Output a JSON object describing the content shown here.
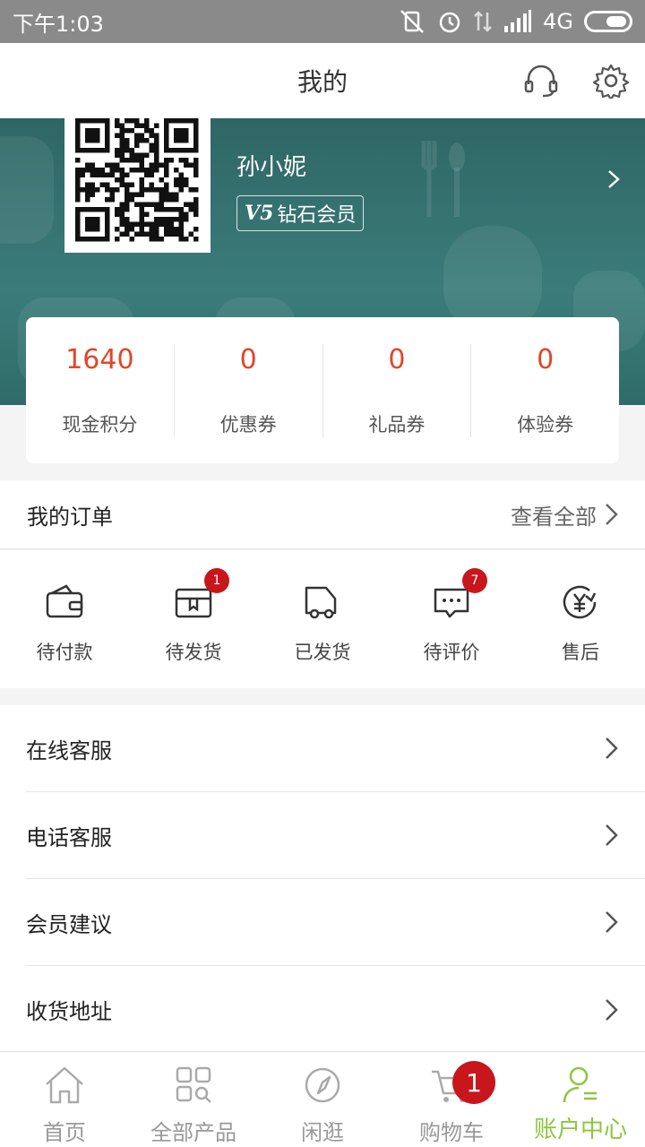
{
  "status": {
    "time": "下午1:03",
    "network": "4G"
  },
  "header": {
    "title": "我的"
  },
  "profile": {
    "name": "孙小妮",
    "level_badge": "V5",
    "level_name": "钻石会员"
  },
  "stats": [
    {
      "value": "1640",
      "label": "现金积分"
    },
    {
      "value": "0",
      "label": "优惠券"
    },
    {
      "value": "0",
      "label": "礼品券"
    },
    {
      "value": "0",
      "label": "体验券"
    }
  ],
  "orders": {
    "title": "我的订单",
    "view_all": "查看全部",
    "items": [
      {
        "label": "待付款",
        "icon": "wallet-icon",
        "badge": ""
      },
      {
        "label": "待发货",
        "icon": "box-icon",
        "badge": "1"
      },
      {
        "label": "已发货",
        "icon": "truck-icon",
        "badge": ""
      },
      {
        "label": "待评价",
        "icon": "comment-icon",
        "badge": "7"
      },
      {
        "label": "售后",
        "icon": "yen-refund-icon",
        "badge": ""
      }
    ]
  },
  "menu": [
    {
      "label": "在线客服"
    },
    {
      "label": "电话客服"
    },
    {
      "label": "会员建议"
    },
    {
      "label": "收货地址"
    }
  ],
  "tabs": [
    {
      "label": "首页",
      "icon": "home-icon"
    },
    {
      "label": "全部产品",
      "icon": "grid-search-icon"
    },
    {
      "label": "闲逛",
      "icon": "compass-icon"
    },
    {
      "label": "购物车",
      "icon": "cart-icon",
      "badge": "1"
    },
    {
      "label": "账户中心",
      "icon": "user-icon",
      "active": true
    }
  ],
  "colors": {
    "accent_red": "#e0472a",
    "badge_red": "#c8161d",
    "active_green": "#8cc63e",
    "banner_teal": "#3b7c7a"
  }
}
